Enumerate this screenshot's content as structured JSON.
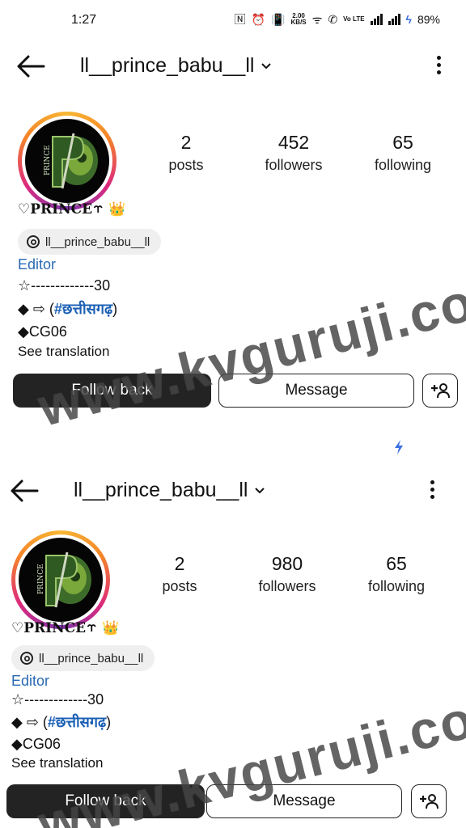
{
  "status": {
    "time": "1:27",
    "net_speed": "2.00",
    "net_unit": "KB/S",
    "volte": "Vo LTE",
    "battery": "89%"
  },
  "profiles": [
    {
      "username": "ll__prince_babu__ll",
      "stats": {
        "posts": "2",
        "posts_label": "posts",
        "followers": "452",
        "followers_label": "followers",
        "following": "65",
        "following_label": "following"
      },
      "full_name": "♡PRINCE⥾ ",
      "crown": "👑",
      "threads_handle": "ll__prince_babu__ll",
      "category": "Editor",
      "bio_line1": "☆-------------30",
      "bio_line2_prefix": "◆ ⇨ (",
      "bio_line2_tag": "#छत्तीसगढ़",
      "bio_line2_suffix": ")",
      "bio_line3": "◆CG06",
      "see_translation": "See translation",
      "follow_back": "Follow back",
      "message": "Message"
    },
    {
      "username": "ll__prince_babu__ll",
      "stats": {
        "posts": "2",
        "posts_label": "posts",
        "followers": "980",
        "followers_label": "followers",
        "following": "65",
        "following_label": "following"
      },
      "full_name": "♡PRINCE⥾ ",
      "crown": "👑",
      "threads_handle": "ll__prince_babu__ll",
      "category": "Editor",
      "bio_line1": "☆-------------30",
      "bio_line2_prefix": "◆ ⇨ (",
      "bio_line2_tag": "#छत्तीसगढ़",
      "bio_line2_suffix": ")",
      "bio_line3": "◆CG06",
      "see_translation": "See translation",
      "follow_back": "Follow back",
      "message": "Message"
    }
  ],
  "watermark": "www.kvguruji.com",
  "avatar_text": "PRINCE",
  "colors": {
    "follow_bg": "#232323",
    "link_blue": "#2a6ab3",
    "tag_blue": "#1a5fb4",
    "ring": "#dd2a7b"
  }
}
